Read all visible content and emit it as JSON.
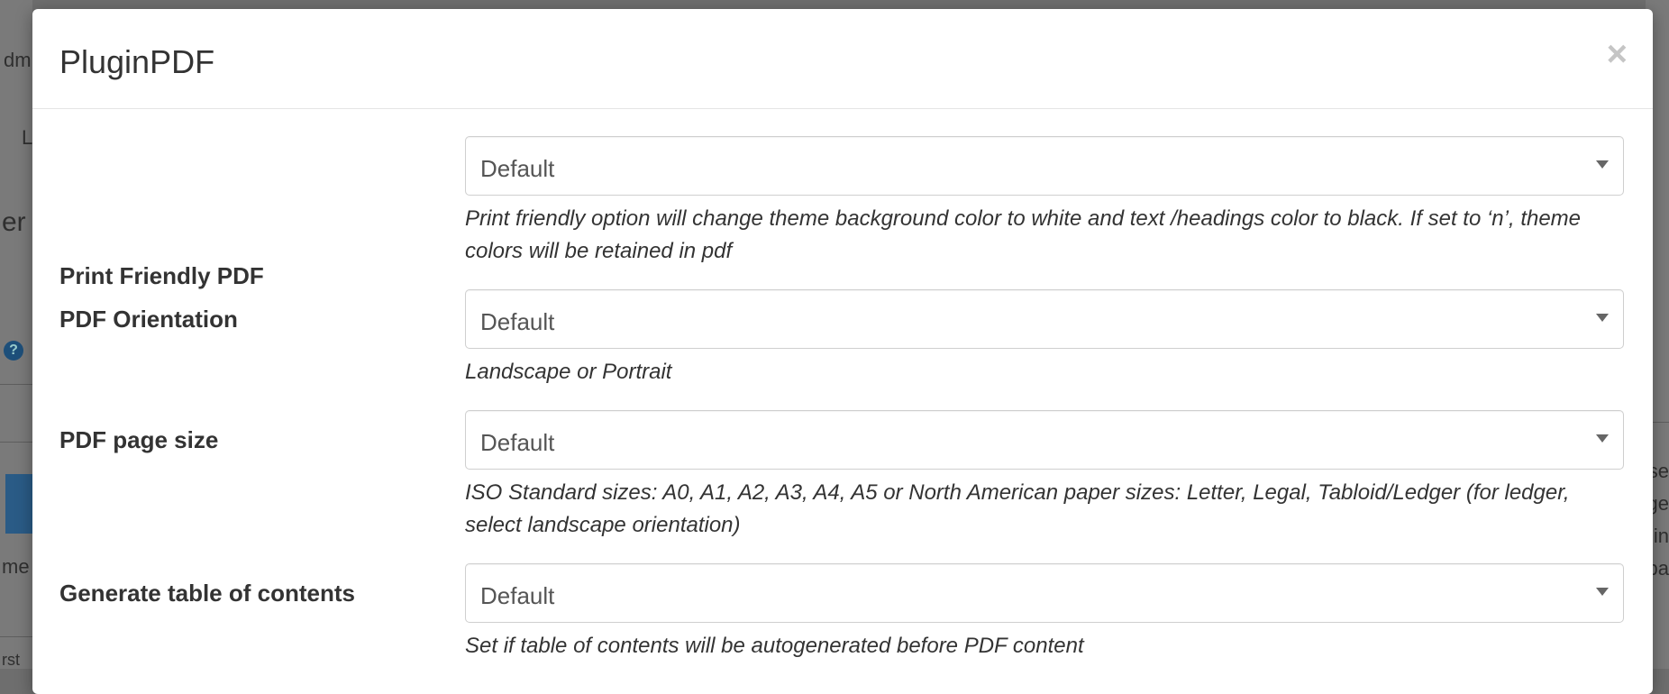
{
  "modal": {
    "title": "PluginPDF",
    "close_label": "×",
    "fields": [
      {
        "label": "Print Friendly PDF",
        "value": "Default",
        "help": "Print friendly option will change theme background color to white and text /headings color to black. If set to ‘n’, theme colors will be retained in pdf"
      },
      {
        "label": "PDF Orientation",
        "value": "Default",
        "help": "Landscape or Portrait"
      },
      {
        "label": "PDF page size",
        "value": "Default",
        "help": "ISO Standard sizes: A0, A1, A2, A3, A4, A5 or North American paper sizes: Letter, Legal, Tabloid/Ledger (for ledger, select landscape orientation)"
      },
      {
        "label": "Generate table of contents",
        "value": "Default",
        "help": "Set if table of contents will be autogenerated before PDF content"
      }
    ]
  },
  "background": {
    "fragments": [
      "dm",
      "L",
      "er",
      "me",
      "rst",
      "se",
      "ge",
      "in",
      "pa"
    ],
    "help_icon": "question-circle-icon"
  }
}
